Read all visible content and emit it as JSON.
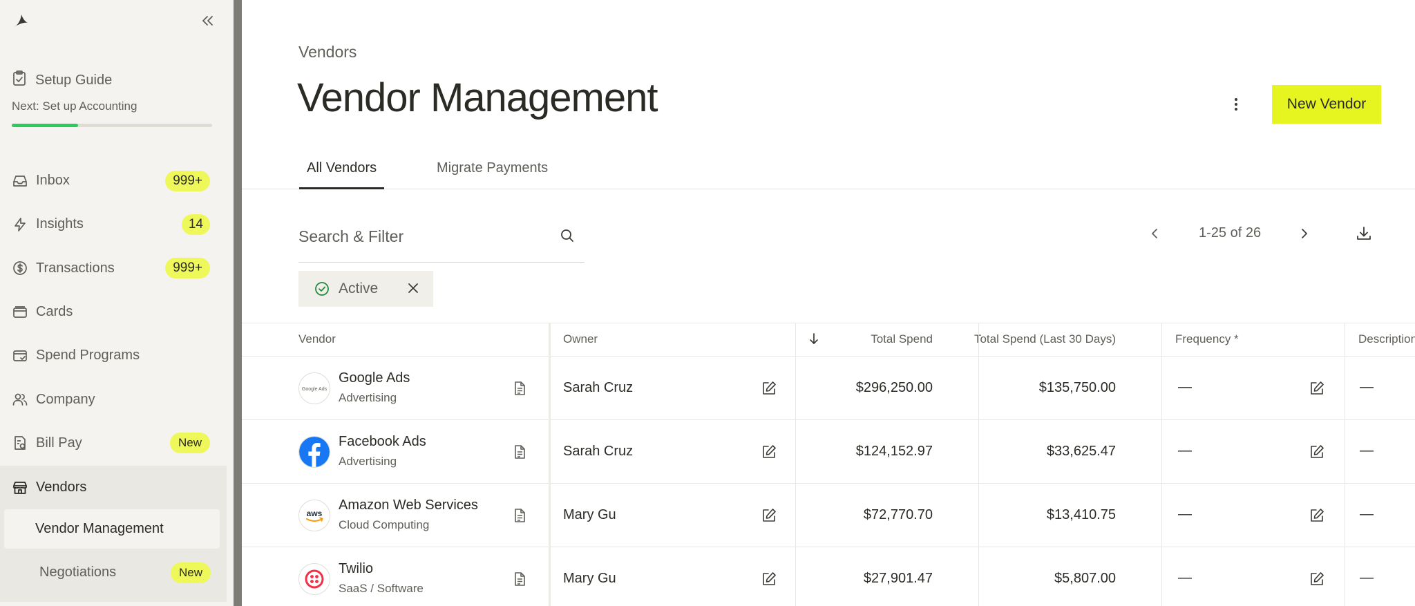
{
  "sidebar": {
    "setup": {
      "title": "Setup Guide",
      "next": "Next: Set up Accounting",
      "progress": 0.33
    },
    "items": [
      {
        "key": "inbox",
        "label": "Inbox",
        "badge": "999+"
      },
      {
        "key": "insights",
        "label": "Insights",
        "badge": "14"
      },
      {
        "key": "transactions",
        "label": "Transactions",
        "badge": "999+"
      },
      {
        "key": "cards",
        "label": "Cards",
        "badge": ""
      },
      {
        "key": "spend-programs",
        "label": "Spend Programs",
        "badge": ""
      },
      {
        "key": "company",
        "label": "Company",
        "badge": ""
      },
      {
        "key": "bill-pay",
        "label": "Bill Pay",
        "badge": "New"
      }
    ],
    "vendors": {
      "label": "Vendors",
      "sub": [
        {
          "label": "Vendor Management",
          "badge": ""
        },
        {
          "label": "Negotiations",
          "badge": "New"
        }
      ]
    }
  },
  "header": {
    "breadcrumb": "Vendors",
    "title": "Vendor Management",
    "new_vendor_label": "New Vendor"
  },
  "tabs": [
    {
      "label": "All Vendors",
      "active": true
    },
    {
      "label": "Migrate Payments",
      "active": false
    }
  ],
  "search": {
    "placeholder": "Search & Filter",
    "value": ""
  },
  "pager": {
    "text": "1-25 of 26"
  },
  "filter": {
    "label": "Active"
  },
  "table": {
    "columns": {
      "vendor": "Vendor",
      "owner": "Owner",
      "total_spend": "Total Spend",
      "total_spend_30": "Total Spend (Last 30 Days)",
      "frequency": "Frequency *",
      "description": "Description"
    },
    "rows": [
      {
        "name": "Google Ads",
        "category": "Advertising",
        "owner": "Sarah Cruz",
        "total": "$296,250.00",
        "last30": "$135,750.00",
        "frequency": "—",
        "description": "—",
        "logo": "google-ads-logo"
      },
      {
        "name": "Facebook Ads",
        "category": "Advertising",
        "owner": "Sarah Cruz",
        "total": "$124,152.97",
        "last30": "$33,625.47",
        "frequency": "—",
        "description": "—",
        "logo": "facebook-logo"
      },
      {
        "name": "Amazon Web Services",
        "category": "Cloud Computing",
        "owner": "Mary Gu",
        "total": "$72,770.70",
        "last30": "$13,410.75",
        "frequency": "—",
        "description": "—",
        "logo": "aws-logo"
      },
      {
        "name": "Twilio",
        "category": "SaaS / Software",
        "owner": "Mary Gu",
        "total": "$27,901.47",
        "last30": "$5,807.00",
        "frequency": "—",
        "description": "—",
        "logo": "twilio-logo"
      }
    ]
  },
  "logos": {
    "google_text": "Google Ads",
    "aws_text": "aws"
  },
  "colors": {
    "accent": "#e6f520",
    "badge": "#eef85a",
    "progress": "#2cc95e",
    "facebook": "#1877f2",
    "twilio": "#f22f46"
  }
}
